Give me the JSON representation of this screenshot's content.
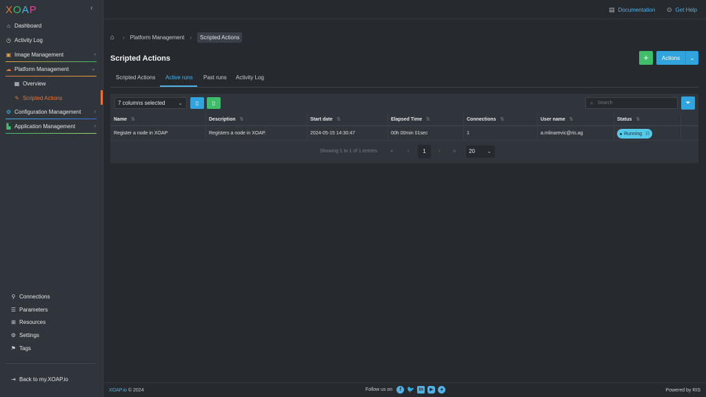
{
  "brand": {
    "logo_text": "XOAP",
    "colors": {
      "accent": "#4fb3e8",
      "active": "#e8743b",
      "success": "#3ebd6a",
      "primary": "#2fa4df"
    }
  },
  "sidebar": {
    "items": [
      {
        "label": "Dashboard",
        "icon": "home-icon"
      },
      {
        "label": "Activity Log",
        "icon": "clock-icon"
      },
      {
        "label": "Image Management",
        "icon": "image-icon"
      },
      {
        "label": "Platform Management",
        "icon": "cloud-icon"
      },
      {
        "label": "Overview",
        "icon": "grid-icon"
      },
      {
        "label": "Scripted Actions",
        "icon": "pencil-icon"
      },
      {
        "label": "Configuration Management",
        "icon": "config-icon"
      },
      {
        "label": "Application Management",
        "icon": "apps-icon"
      }
    ],
    "bottom": [
      {
        "label": "Connections",
        "icon": "link-icon"
      },
      {
        "label": "Parameters",
        "icon": "list-icon"
      },
      {
        "label": "Resources",
        "icon": "resources-icon"
      },
      {
        "label": "Settings",
        "icon": "gear-icon"
      },
      {
        "label": "Tags",
        "icon": "bookmark-icon"
      }
    ],
    "back_link": "Back to my.XOAP.io"
  },
  "topbar": {
    "documentation": "Documentation",
    "help": "Get Help"
  },
  "breadcrumb": {
    "items": [
      "Platform Management",
      "Scripted Actions"
    ]
  },
  "page": {
    "title": "Scripted Actions",
    "add_label": "+",
    "actions_label": "Actions"
  },
  "tabs": [
    "Scripted Actions",
    "Active runs",
    "Past runs",
    "Activity Log"
  ],
  "table": {
    "columns_selected": "7 columns selected",
    "search_placeholder": "Search",
    "columns": [
      "Name",
      "Description",
      "Start date",
      "Elapsed Time",
      "Connections",
      "User name",
      "Status"
    ],
    "rows": [
      {
        "name": "Register a node in XOAP",
        "description": "Registers a node in XOAP.",
        "start_date": "2024-05-15 14:30:47",
        "elapsed": "00h 00min 01sec",
        "connections": "1",
        "user": "a.mlinarevic@ris.ag",
        "status": "Running"
      }
    ],
    "showing": "Showing 1 to 1 of 1 entries",
    "current_page": "1",
    "page_size": "20"
  },
  "footer": {
    "copyright_brand": "XOAP.io",
    "copyright_year": "© 2024",
    "follow": "Follow us on",
    "powered": "Powered by RIS"
  }
}
